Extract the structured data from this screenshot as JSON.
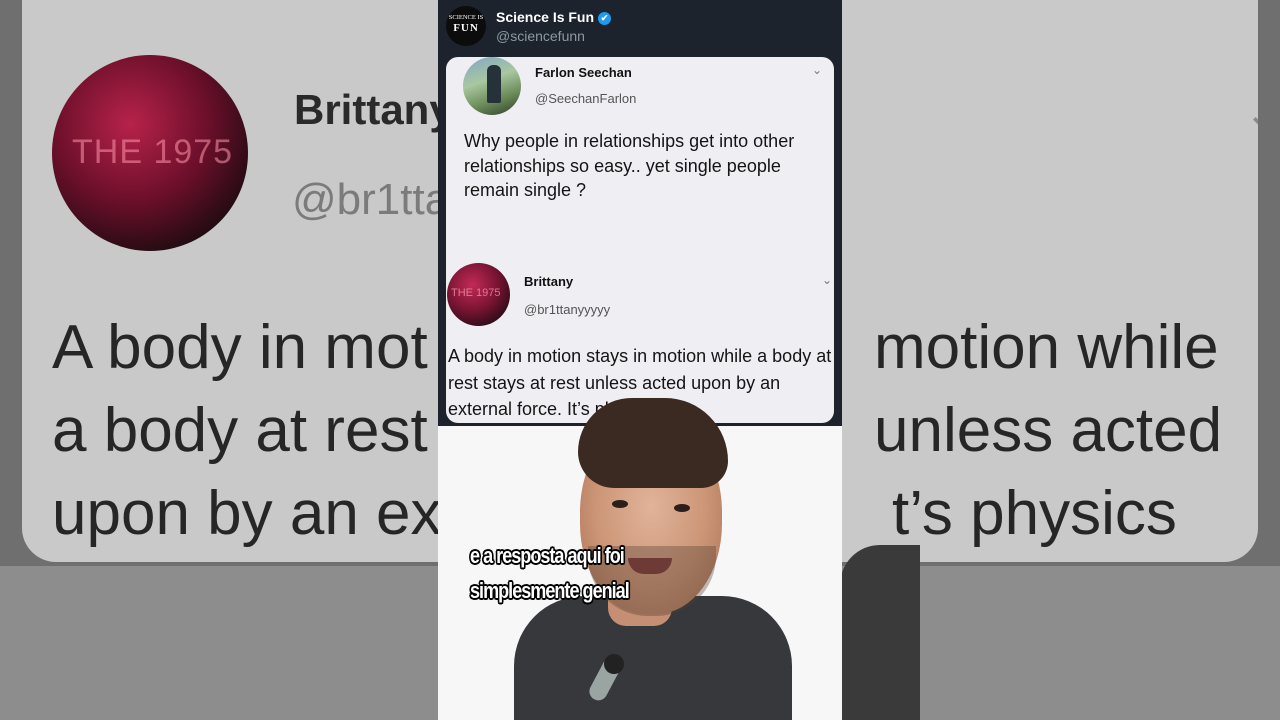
{
  "background": {
    "name": "Brittany",
    "handle": "@br1tta",
    "avatar_text": "THE 1975",
    "lines": [
      "A body in mot",
      "a body at rest",
      "upon by an ex"
    ],
    "lines_right": [
      "motion while",
      "unless acted",
      "t’s physics"
    ]
  },
  "source": {
    "name": "Science Is Fun",
    "handle": "@sciencefunn",
    "logo_line1": "SCIENCE IS",
    "logo_line2": "FUN",
    "verified_icon": "✔"
  },
  "tweet1": {
    "name": "Farlon Seechan",
    "handle": "@SeechanFarlon",
    "text": "Why people in relationships get into other relationships so easy.. yet single people remain single ?"
  },
  "tweet2": {
    "name": "Brittany",
    "handle": "@br1ttanyyyyy",
    "avatar_text": "THE 1975",
    "text": "A body in motion stays in motion while a body at rest stays at rest unless acted upon by an external force. It’s physics"
  },
  "caption": {
    "line1": "e a resposta aqui foi",
    "line2": "simplesmente genial"
  },
  "icons": {
    "chevron": "⌄"
  }
}
